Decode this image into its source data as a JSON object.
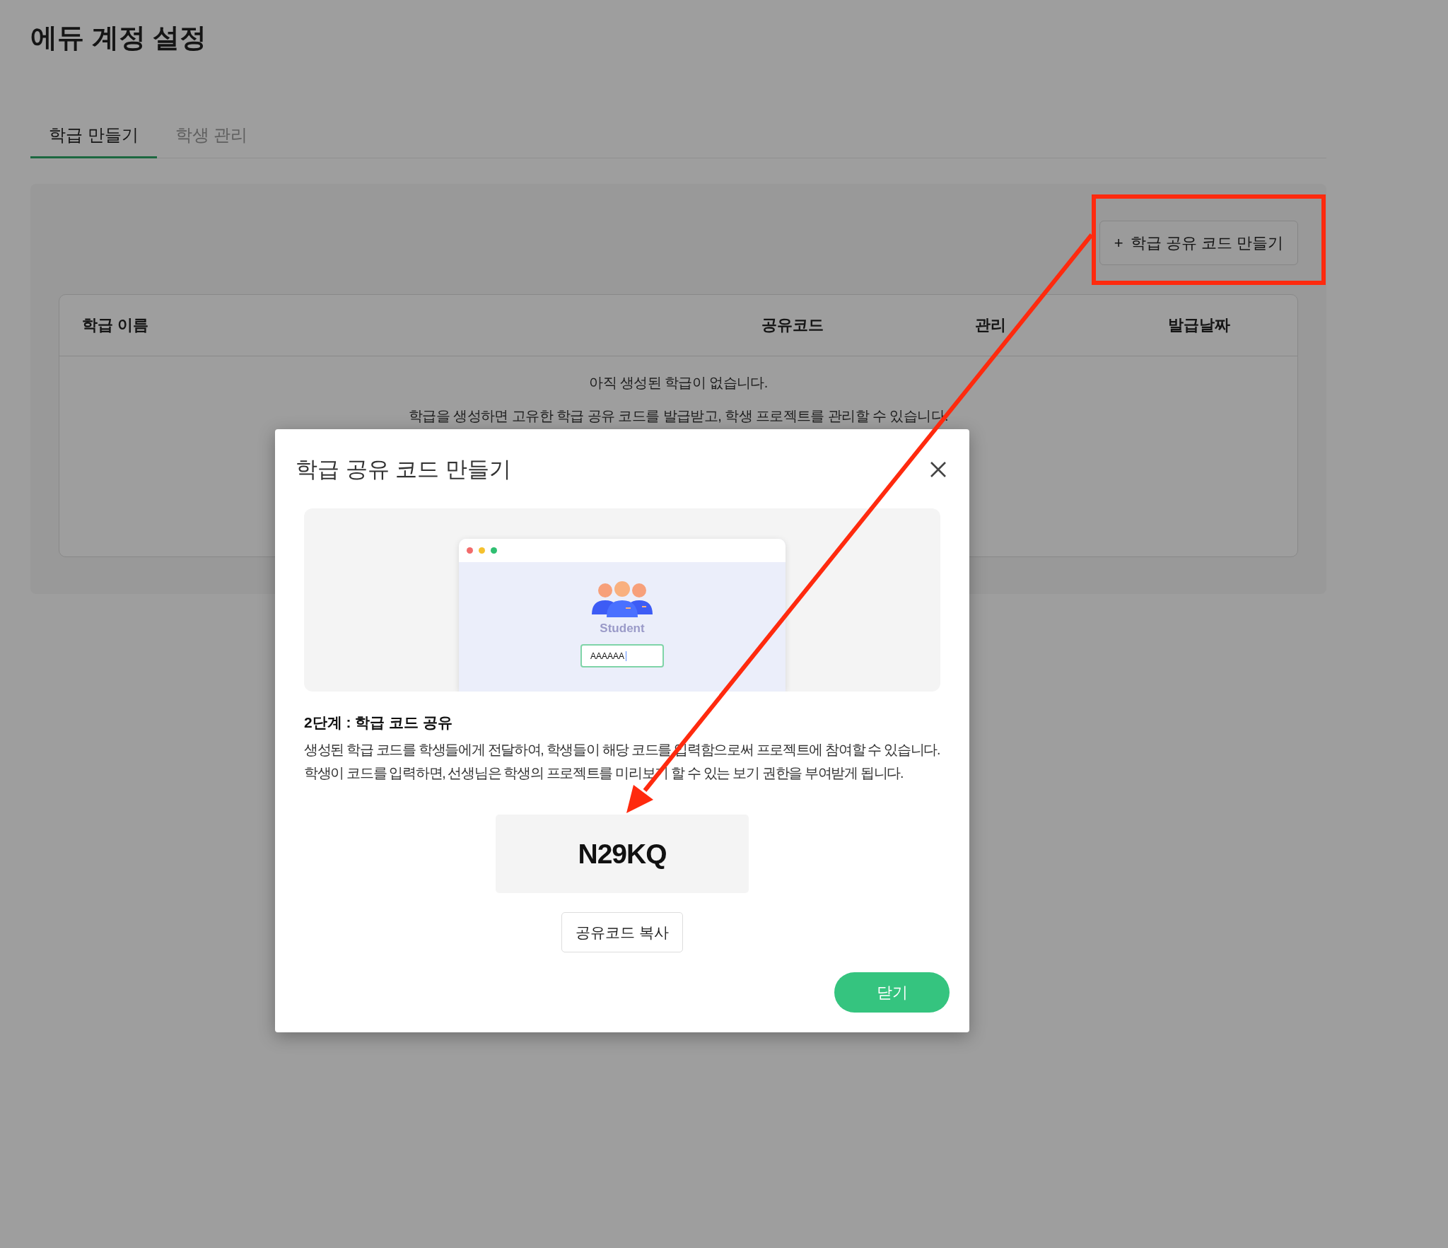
{
  "page_title": "에듀 계정 설정",
  "tabs": [
    {
      "label": "학급 만들기",
      "selected": true
    },
    {
      "label": "학생 관리",
      "selected": false
    }
  ],
  "create_button": {
    "icon": "+",
    "label": "학급 공유 코드 만들기"
  },
  "table": {
    "columns": [
      "학급 이름",
      "공유코드",
      "관리",
      "발급날짜"
    ],
    "empty_messages": [
      "아직 생성된 학급이 없습니다.",
      "학급을 생성하면 고유한 학급 공유 코드를 발급받고, 학생 프로젝트를 관리할 수 있습니다."
    ]
  },
  "modal": {
    "title": "학급 공유 코드 만들기",
    "illustration": {
      "label": "Student",
      "input_value": "AAAAAA"
    },
    "step_title": "2단계 : 학급 코드 공유",
    "description": "생성된 학급 코드를 학생들에게 전달하여, 학생들이 해당 코드를 입력함으로써 프로젝트에 참여할 수 있습니다. 학생이 코드를 입력하면, 선생님은 학생의 프로젝트를 미리보기 할 수 있는 보기 권한을 부여받게 됩니다.",
    "code": "N29KQ",
    "copy_button": "공유코드 복사",
    "close_button": "닫기"
  }
}
